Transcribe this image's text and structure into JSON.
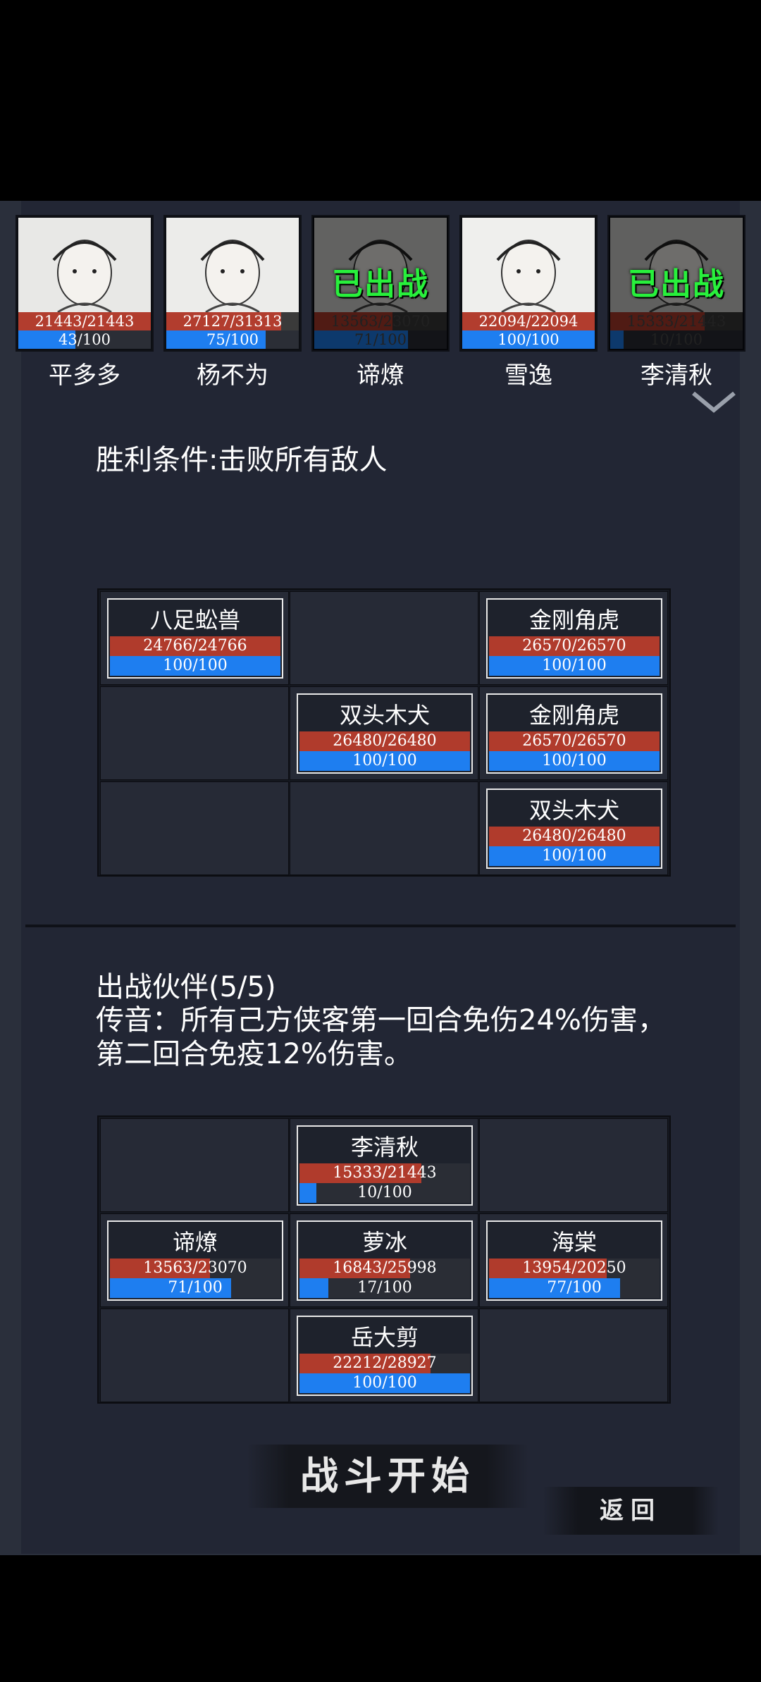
{
  "heroes": [
    {
      "name": "平多多",
      "hp_text": "21443/21443",
      "hp_frac": 1.0,
      "mp_text": "43/100",
      "mp_frac": 0.43,
      "deployed": false
    },
    {
      "name": "杨不为",
      "hp_text": "27127/31313",
      "hp_frac": 0.866,
      "mp_text": "75/100",
      "mp_frac": 0.75,
      "deployed": false
    },
    {
      "name": "谛燎",
      "hp_text": "13563/23070",
      "hp_frac": 0.588,
      "mp_text": "71/100",
      "mp_frac": 0.71,
      "deployed": true
    },
    {
      "name": "雪逸",
      "hp_text": "22094/22094",
      "hp_frac": 1.0,
      "mp_text": "100/100",
      "mp_frac": 1.0,
      "deployed": false
    },
    {
      "name": "李清秋",
      "hp_text": "15333/21443",
      "hp_frac": 0.715,
      "mp_text": "10/100",
      "mp_frac": 0.1,
      "deployed": true
    }
  ],
  "deployed_label": "已出战",
  "victory_text": "胜利条件:击败所有敌人",
  "enemy_grid": [
    {
      "row": 0,
      "col": 0,
      "name": "八足蚣兽",
      "hp_text": "24766/24766",
      "hp_frac": 1.0,
      "mp_text": "100/100",
      "mp_frac": 1.0
    },
    {
      "row": 0,
      "col": 2,
      "name": "金刚角虎",
      "hp_text": "26570/26570",
      "hp_frac": 1.0,
      "mp_text": "100/100",
      "mp_frac": 1.0
    },
    {
      "row": 1,
      "col": 1,
      "name": "双头木犬",
      "hp_text": "26480/26480",
      "hp_frac": 1.0,
      "mp_text": "100/100",
      "mp_frac": 1.0
    },
    {
      "row": 1,
      "col": 2,
      "name": "金刚角虎",
      "hp_text": "26570/26570",
      "hp_frac": 1.0,
      "mp_text": "100/100",
      "mp_frac": 1.0
    },
    {
      "row": 2,
      "col": 2,
      "name": "双头木犬",
      "hp_text": "26480/26480",
      "hp_frac": 1.0,
      "mp_text": "100/100",
      "mp_frac": 1.0
    }
  ],
  "partners_title": "出战伙伴(5/5)",
  "partners_note": "传音：所有己方侠客第一回合免伤24%伤害，第二回合免疫12%伤害。",
  "ally_grid": [
    {
      "row": 0,
      "col": 1,
      "name": "李清秋",
      "hp_text": "15333/21443",
      "hp_frac": 0.715,
      "mp_text": "10/100",
      "mp_frac": 0.1
    },
    {
      "row": 1,
      "col": 0,
      "name": "谛燎",
      "hp_text": "13563/23070",
      "hp_frac": 0.588,
      "mp_text": "71/100",
      "mp_frac": 0.71
    },
    {
      "row": 1,
      "col": 1,
      "name": "萝冰",
      "hp_text": "16843/25998",
      "hp_frac": 0.648,
      "mp_text": "17/100",
      "mp_frac": 0.17
    },
    {
      "row": 1,
      "col": 2,
      "name": "海棠",
      "hp_text": "13954/20250",
      "hp_frac": 0.689,
      "mp_text": "77/100",
      "mp_frac": 0.77
    },
    {
      "row": 2,
      "col": 1,
      "name": "岳大剪",
      "hp_text": "22212/28927",
      "hp_frac": 0.768,
      "mp_text": "100/100",
      "mp_frac": 1.0
    }
  ],
  "start_label": "战斗开始",
  "back_label": "返回",
  "colors": {
    "hp": "#b03b2c",
    "mp": "#1e7ef0",
    "deployed": "#28f03c"
  }
}
